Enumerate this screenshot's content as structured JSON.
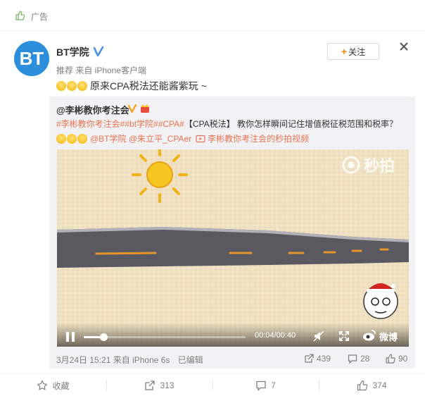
{
  "ad": {
    "label": "广告"
  },
  "post": {
    "username": "BT学院",
    "meta": "推荐 来自 iPhone客户端",
    "text": "原来CPA税法还能酱紫玩 ~",
    "follow_label": "关注",
    "avatar_text": "BT"
  },
  "repost": {
    "username": "@李彬教你考注会",
    "line1_tags": "#李彬教你考注会##bt学院##CPA#",
    "line1_text": "【CPA税法】 教你怎样瞬间记住增值税征税范围和税率？",
    "mentions": "@BT学院 @朱立平_CPAer",
    "video_link": "李彬教你考注会的秒拍视频",
    "time_info": "3月24日 15:21 来自 iPhone 6s",
    "edited": "已编辑",
    "stats": {
      "reposts": "439",
      "comments": "28",
      "likes": "90"
    }
  },
  "video": {
    "watermark": "秒拍",
    "time": "00:04/00:40",
    "progress": 0.12,
    "weibo_label": "微博"
  },
  "actions": {
    "favorite": "收藏",
    "repost": "313",
    "comment": "7",
    "like": "374"
  },
  "colors": {
    "link": "#eb7350",
    "accent": "#ff8200",
    "verified": "#4a90e2",
    "brand_blue": "#2b8fde"
  }
}
